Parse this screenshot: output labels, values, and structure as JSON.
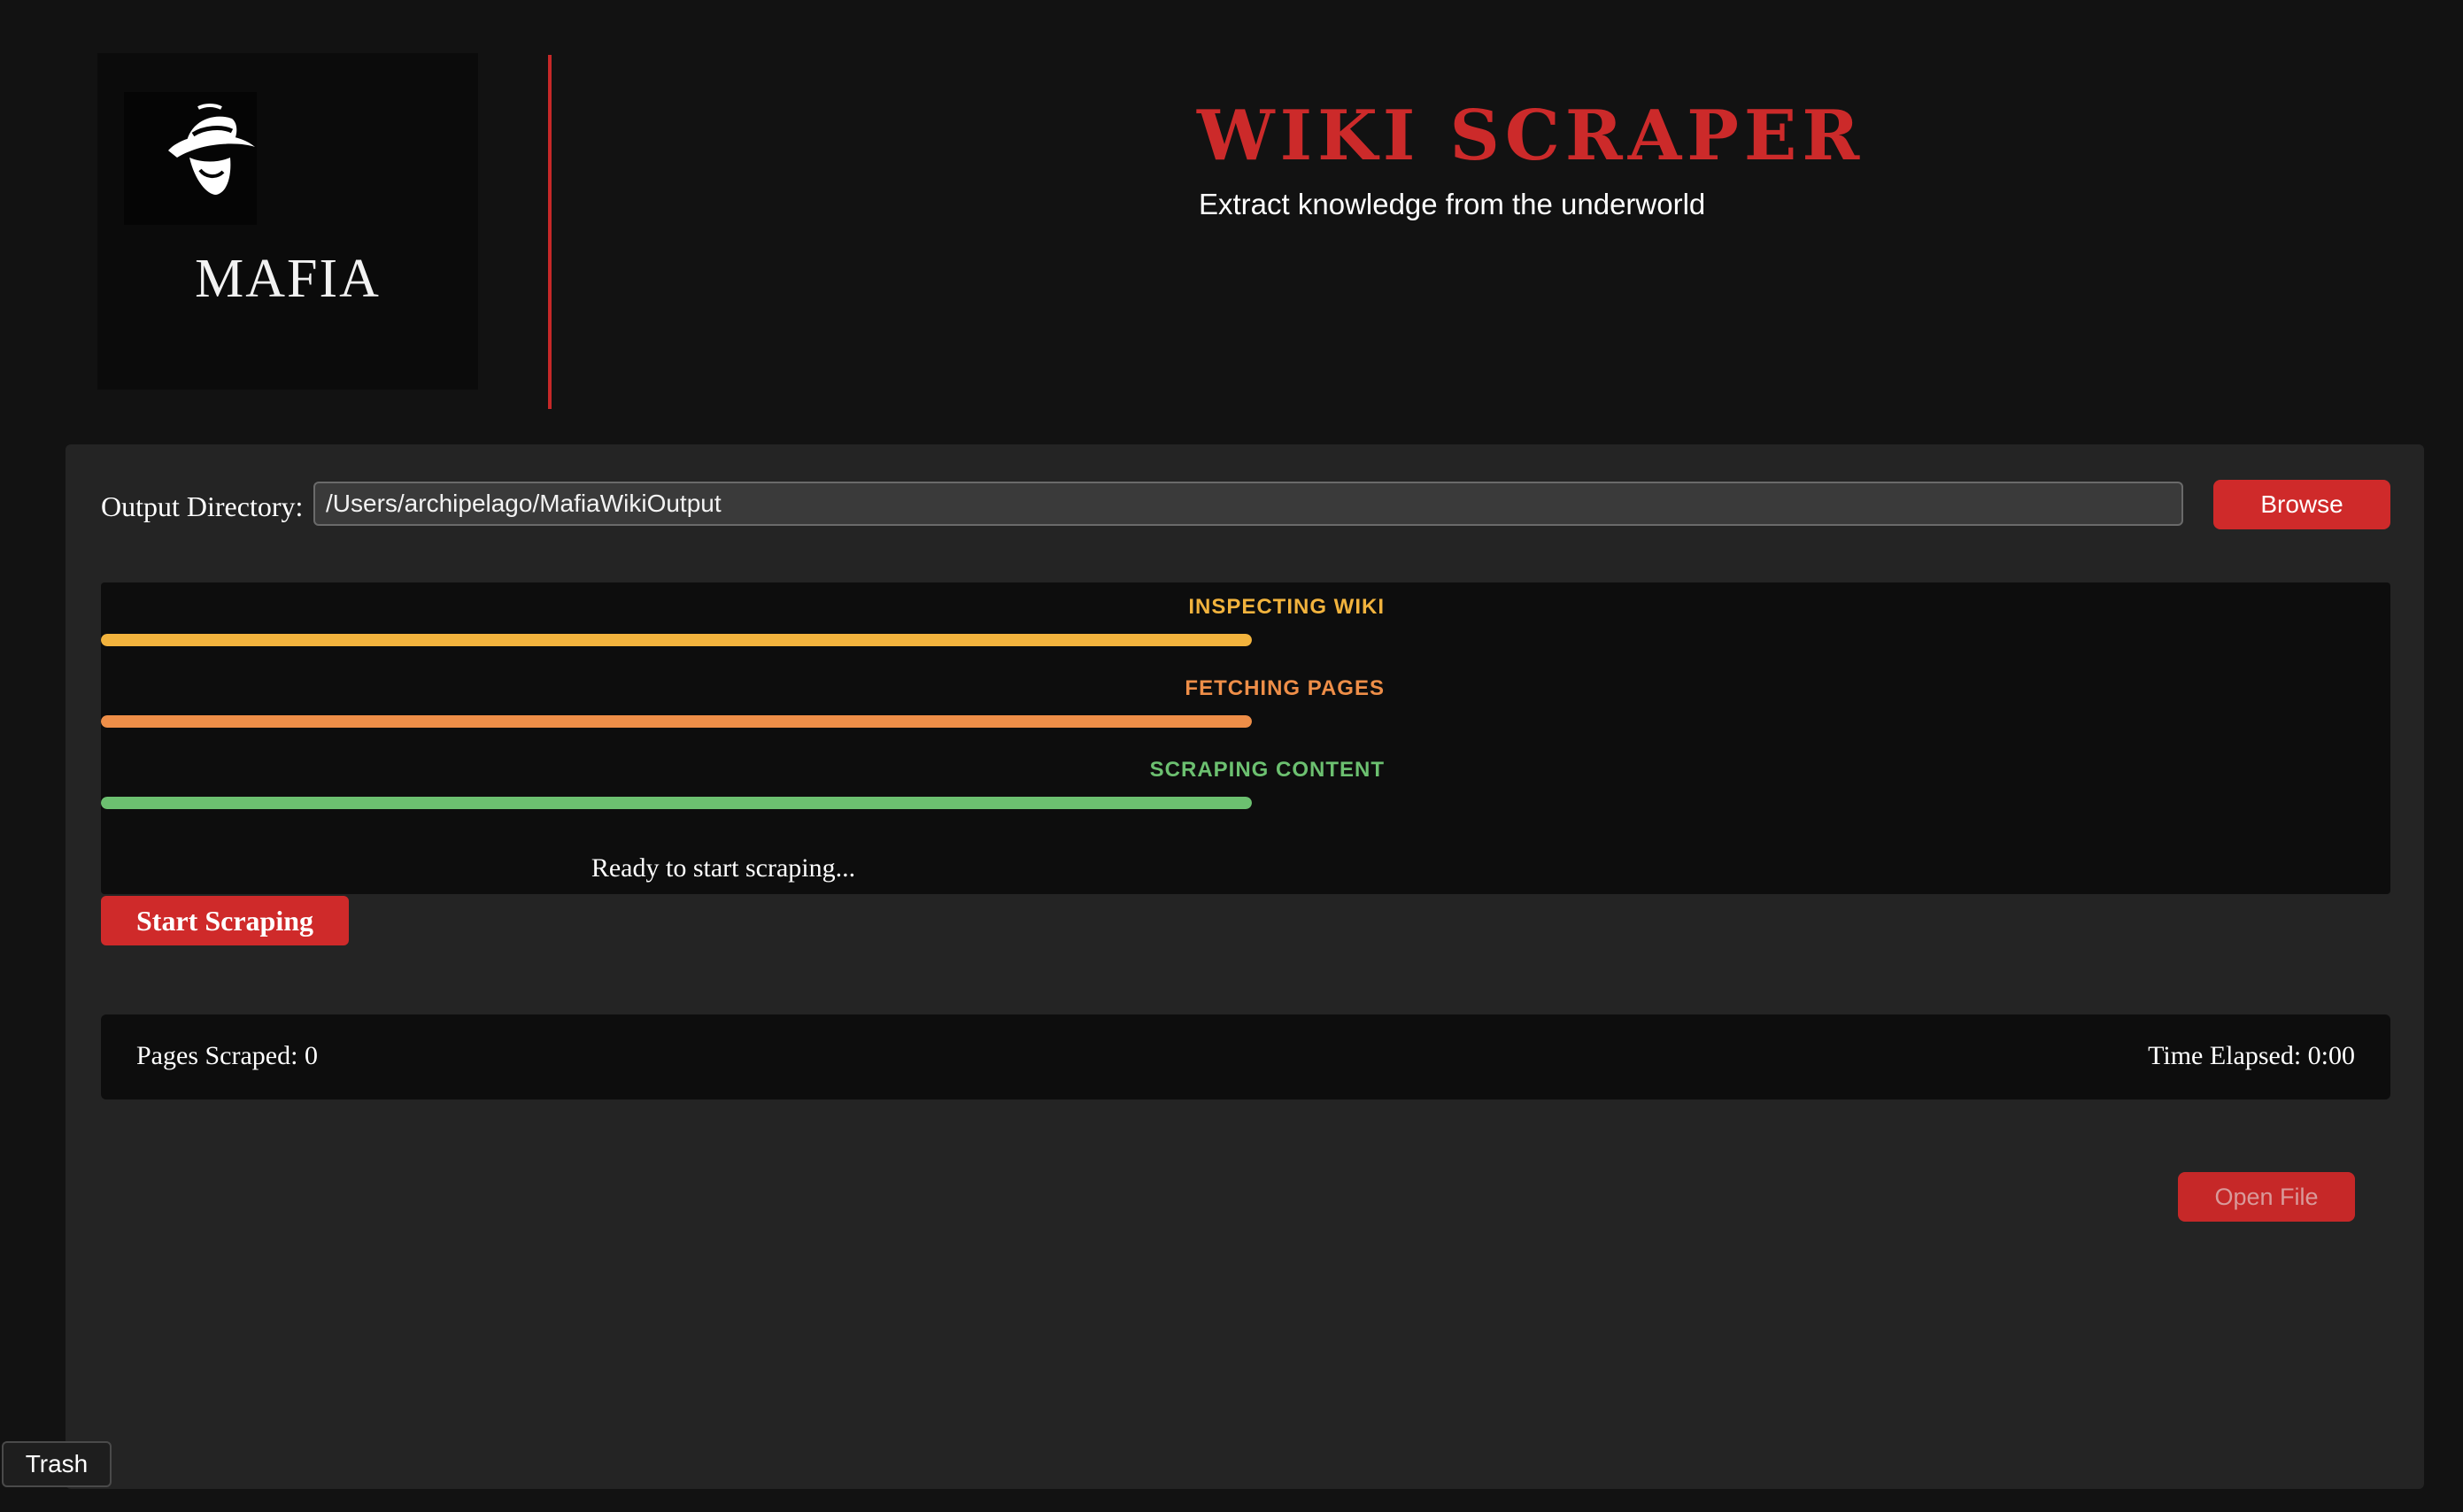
{
  "header": {
    "logo_text": "MAFIA",
    "title": "WIKI SCRAPER",
    "subtitle": "Extract knowledge from the underworld"
  },
  "output": {
    "label": "Output Directory:",
    "value": "/Users/archipelago/MafiaWikiOutput",
    "browse_label": "Browse"
  },
  "progress": {
    "stages": [
      {
        "label": "INSPECTING WIKI",
        "color": "#f2b33d",
        "fraction": 1.0
      },
      {
        "label": "FETCHING PAGES",
        "color": "#ee8e48",
        "fraction": 1.0
      },
      {
        "label": "SCRAPING CONTENT",
        "color": "#6cc070",
        "fraction": 1.0
      }
    ],
    "status": "Ready to start scraping..."
  },
  "actions": {
    "start_label": "Start Scraping",
    "open_file_label": "Open File"
  },
  "stats": {
    "pages_scraped": "Pages Scraped: 0",
    "time_elapsed": "Time Elapsed: 0:00"
  },
  "dock": {
    "trash_label": "Trash"
  },
  "colors": {
    "accent": "#cf2a2a",
    "background": "#121212",
    "panel": "#242424"
  }
}
